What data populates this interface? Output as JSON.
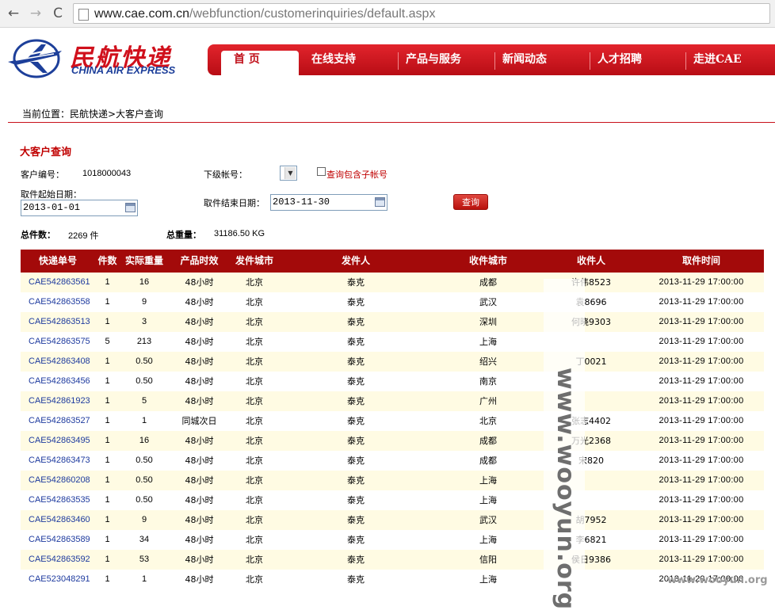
{
  "browser": {
    "url_host": "www.cae.com.cn",
    "url_path": "/webfunction/customerinquiries/default.aspx",
    "back_glyph": "←",
    "forward_glyph": "→",
    "reload_glyph": "C"
  },
  "site": {
    "logo_cn": "民航快递",
    "logo_en": "CHINA AIR EXPRESS",
    "nav": [
      "首 页",
      "在线支持",
      "产品与服务",
      "新闻动态",
      "人才招聘",
      "走进CAE"
    ]
  },
  "breadcrumb": "当前位置：民航快递>大客户查询",
  "form": {
    "title": "大客户查询",
    "customer_no_label": "客户编号：",
    "customer_no": "1018000043",
    "sub_account_label": "下级帐号：",
    "include_sub_label": "查询包含子帐号",
    "start_date_label": "取件起始日期：",
    "start_date": "2013-01-01",
    "end_date_label": "取件结束日期：",
    "end_date": "2013-11-30",
    "query_button": "查询",
    "total_count_label": "总件数：",
    "total_count": "2269 件",
    "total_weight_label": "总重量：",
    "total_weight": "31186.50 KG"
  },
  "table": {
    "headers": [
      "快递单号",
      "件数",
      "实际重量",
      "产品时效",
      "发件城市",
      "发件人",
      "收件城市",
      "收件人",
      "取件时间"
    ],
    "rows": [
      [
        "CAE542863561",
        "1",
        "16",
        "48小时",
        "北京",
        "泰克",
        "成都",
        "许伟8523",
        "2013-11-29 17:00:00"
      ],
      [
        "CAE542863558",
        "1",
        "9",
        "48小时",
        "北京",
        "泰克",
        "武汉",
        "袁8696",
        "2013-11-29 17:00:00"
      ],
      [
        "CAE542863513",
        "1",
        "3",
        "48小时",
        "北京",
        "泰克",
        "深圳",
        "何晓9303",
        "2013-11-29 17:00:00"
      ],
      [
        "CAE542863575",
        "5",
        "213",
        "48小时",
        "北京",
        "泰克",
        "上海",
        "",
        "2013-11-29 17:00:00"
      ],
      [
        "CAE542863408",
        "1",
        "0.50",
        "48小时",
        "北京",
        "泰克",
        "绍兴",
        "丁0021",
        "2013-11-29 17:00:00"
      ],
      [
        "CAE542863456",
        "1",
        "0.50",
        "48小时",
        "北京",
        "泰克",
        "南京",
        "",
        "2013-11-29 17:00:00"
      ],
      [
        "CAE542861923",
        "1",
        "5",
        "48小时",
        "北京",
        "泰克",
        "广州",
        "",
        "2013-11-29 17:00:00"
      ],
      [
        "CAE542863527",
        "1",
        "1",
        "同城次日",
        "北京",
        "泰克",
        "北京",
        "张志4402",
        "2013-11-29 17:00:00"
      ],
      [
        "CAE542863495",
        "1",
        "16",
        "48小时",
        "北京",
        "泰克",
        "成都",
        "万光2368",
        "2013-11-29 17:00:00"
      ],
      [
        "CAE542863473",
        "1",
        "0.50",
        "48小时",
        "北京",
        "泰克",
        "成都",
        "宋820",
        "2013-11-29 17:00:00"
      ],
      [
        "CAE542860208",
        "1",
        "0.50",
        "48小时",
        "北京",
        "泰克",
        "上海",
        "",
        "2013-11-29 17:00:00"
      ],
      [
        "CAE542863535",
        "1",
        "0.50",
        "48小时",
        "北京",
        "泰克",
        "上海",
        "",
        "2013-11-29 17:00:00"
      ],
      [
        "CAE542863460",
        "1",
        "9",
        "48小时",
        "北京",
        "泰克",
        "武汉",
        "胡7952",
        "2013-11-29 17:00:00"
      ],
      [
        "CAE542863589",
        "1",
        "34",
        "48小时",
        "北京",
        "泰克",
        "上海",
        "李6821",
        "2013-11-29 17:00:00"
      ],
      [
        "CAE542863592",
        "1",
        "53",
        "48小时",
        "北京",
        "泰克",
        "信阳",
        "侯日9386",
        "2013-11-29 17:00:00"
      ],
      [
        "CAE523048291",
        "1",
        "1",
        "48小时",
        "北京",
        "泰克",
        "上海",
        "",
        "2013-11-29 17:00:00"
      ]
    ]
  },
  "watermark": {
    "text": "www.wooyun.org",
    "corner": "www.wooyun.org"
  },
  "colors": {
    "brand_red": "#c8101a",
    "header_bg": "#a30a0a",
    "link_blue": "#1d3a9e",
    "row_alt": "#fffbe3"
  }
}
